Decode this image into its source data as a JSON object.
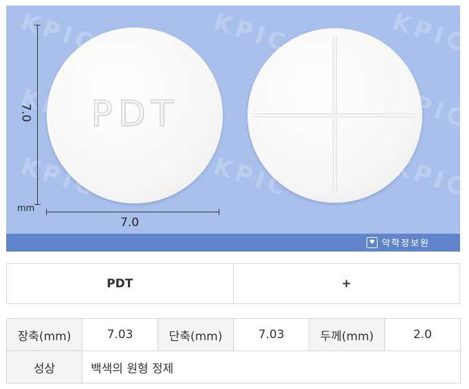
{
  "photo": {
    "watermark": "KPIC",
    "front_imprint": "PDT",
    "dimension_vertical": "7.0",
    "dimension_horizontal": "7.0",
    "unit": "mm",
    "logo_text": "약학정보원",
    "colors": {
      "background": "#a9c0ec",
      "band": "#5f84c9",
      "tablet": "#f7f7f7"
    }
  },
  "markings": {
    "front": "PDT",
    "back": "+"
  },
  "specs": {
    "long_axis_label": "장축(mm)",
    "long_axis_value": "7.03",
    "short_axis_label": "단축(mm)",
    "short_axis_value": "7.03",
    "thickness_label": "두께(mm)",
    "thickness_value": "2.0",
    "appearance_label": "성상",
    "appearance_value": "백색의 원형 정제"
  }
}
